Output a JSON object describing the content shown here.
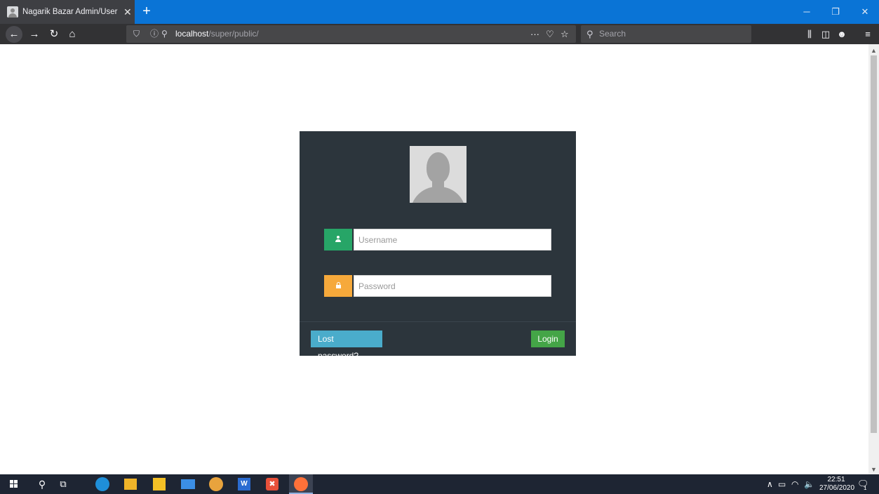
{
  "browser": {
    "tab_title": "Nagarik Bazar Admin/User Log",
    "tab_close": "✕",
    "new_tab": "+",
    "url_host": "localhost",
    "url_path": "/super/public/",
    "search_placeholder": "Search",
    "window_controls": {
      "minimize": "─",
      "restore": "❐",
      "close": "✕"
    },
    "nav_icons": {
      "back": "←",
      "forward": "→",
      "reload": "↻",
      "home": "⌂"
    },
    "url_icons": {
      "shield": "⛉",
      "info": "ⓘ",
      "perm": "⚲",
      "more": "···",
      "pocket": "♡",
      "bookmark": "☆"
    },
    "toolbar_icons": {
      "library": "⫼",
      "sidebar": "◫",
      "account": "☻",
      "menu": "≡"
    }
  },
  "login": {
    "username_placeholder": "Username",
    "password_placeholder": "Password",
    "lost_password_label": "Lost password?",
    "login_label": "Login",
    "colors": {
      "panel": "#2c353c",
      "user_addon": "#27a567",
      "lock_addon": "#f6a93b",
      "lost_button": "#4aaccb",
      "login_button": "#44a547"
    }
  },
  "taskbar": {
    "time": "22:51",
    "date": "27/06/2020",
    "tray_icons": [
      "chevron-up-icon",
      "battery-icon",
      "wifi-icon",
      "volume-icon"
    ],
    "tray_glyphs": [
      "∧",
      "▭",
      "◠",
      "🔈"
    ],
    "notification_glyph": "🗨",
    "notification_count": "1",
    "apps": [
      "edge-icon",
      "file-explorer-icon",
      "store-icon",
      "mail-icon",
      "chrome-icon",
      "word-icon",
      "xampp-icon",
      "firefox-icon"
    ],
    "app_colors": [
      "#1f8fd9",
      "#f0b429",
      "#f4c026",
      "#3b8ee6",
      "#e8a33d",
      "#2b6cd1",
      "#e8503a",
      "#ff7139"
    ],
    "app_glyphs": [
      "",
      "",
      "",
      "",
      "",
      "W",
      "✖",
      ""
    ]
  }
}
